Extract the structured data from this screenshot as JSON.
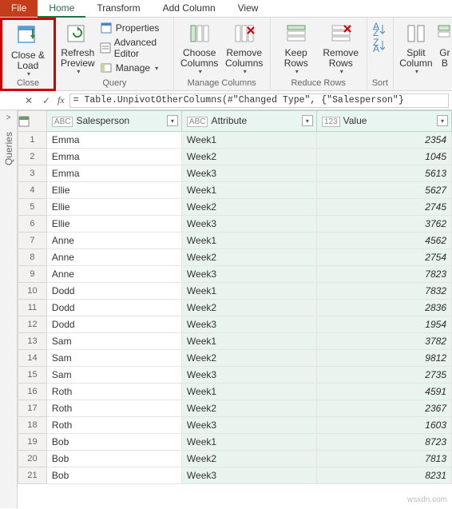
{
  "tabs": {
    "file": "File",
    "home": "Home",
    "transform": "Transform",
    "addColumn": "Add Column",
    "view": "View"
  },
  "ribbon": {
    "close": {
      "closeLoad": "Close &\nLoad",
      "group": "Close"
    },
    "query": {
      "refresh": "Refresh\nPreview",
      "properties": "Properties",
      "advanced": "Advanced Editor",
      "manage": "Manage",
      "group": "Query"
    },
    "manageCols": {
      "choose": "Choose\nColumns",
      "remove": "Remove\nColumns",
      "group": "Manage Columns"
    },
    "reduceRows": {
      "keep": "Keep\nRows",
      "remove": "Remove\nRows",
      "group": "Reduce Rows"
    },
    "sort": {
      "group": "Sort"
    },
    "split": {
      "split": "Split\nColumn",
      "group": "Gr\nB"
    }
  },
  "formula": "= Table.UnpivotOtherColumns(#\"Changed Type\", {\"Salesperson\"}",
  "sidebar": {
    "label": "Queries"
  },
  "columns": {
    "c1": "Salesperson",
    "c2": "Attribute",
    "c3": "Value",
    "t1": "ABC",
    "t2": "ABC",
    "t3": "123"
  },
  "chart_data": {
    "type": "table",
    "columns": [
      "Salesperson",
      "Attribute",
      "Value"
    ],
    "rows": [
      [
        "Emma",
        "Week1",
        2354
      ],
      [
        "Emma",
        "Week2",
        1045
      ],
      [
        "Emma",
        "Week3",
        5613
      ],
      [
        "Ellie",
        "Week1",
        5627
      ],
      [
        "Ellie",
        "Week2",
        2745
      ],
      [
        "Ellie",
        "Week3",
        3762
      ],
      [
        "Anne",
        "Week1",
        4562
      ],
      [
        "Anne",
        "Week2",
        2754
      ],
      [
        "Anne",
        "Week3",
        7823
      ],
      [
        "Dodd",
        "Week1",
        7832
      ],
      [
        "Dodd",
        "Week2",
        2836
      ],
      [
        "Dodd",
        "Week3",
        1954
      ],
      [
        "Sam",
        "Week1",
        3782
      ],
      [
        "Sam",
        "Week2",
        9812
      ],
      [
        "Sam",
        "Week3",
        2735
      ],
      [
        "Roth",
        "Week1",
        4591
      ],
      [
        "Roth",
        "Week2",
        2367
      ],
      [
        "Roth",
        "Week3",
        1603
      ],
      [
        "Bob",
        "Week1",
        8723
      ],
      [
        "Bob",
        "Week2",
        7813
      ],
      [
        "Bob",
        "Week3",
        8231
      ]
    ]
  },
  "watermark": "wsxdn.com"
}
